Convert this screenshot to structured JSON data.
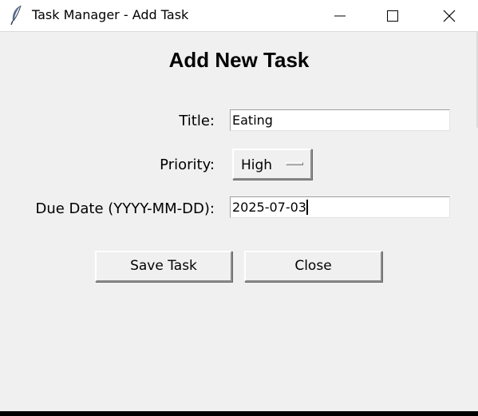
{
  "window": {
    "title": "Task Manager - Add Task",
    "icon": "feather-icon",
    "controls": [
      "minimize-icon",
      "maximize-icon",
      "close-icon"
    ]
  },
  "form": {
    "heading": "Add New Task",
    "title_label": "Title:",
    "title_value": "Eating",
    "priority_label": "Priority:",
    "priority_value": "High",
    "due_label": "Due Date (YYYY-MM-DD):",
    "due_value": "2025-07-03"
  },
  "buttons": {
    "save_label": "Save Task",
    "close_label": "Close"
  },
  "colors": {
    "window_bg": "#f0f0f0",
    "titlebar_bg": "#ffffff",
    "entry_bg": "#ffffff"
  }
}
